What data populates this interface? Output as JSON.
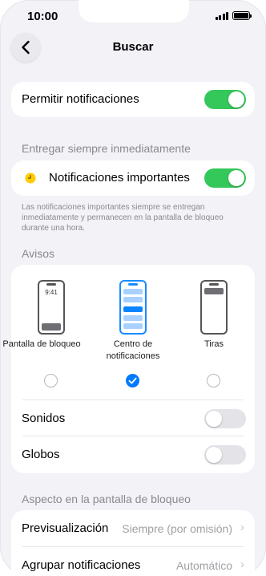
{
  "status": {
    "time": "10:00"
  },
  "header": {
    "title": "Buscar"
  },
  "allow": {
    "label": "Permitir notificaciones",
    "on": true
  },
  "immediate": {
    "header": "Entregar siempre inmediatamente",
    "label": "Notificaciones importantes",
    "on": true,
    "footnote": "Las notificaciones importantes siempre se entregan inmediatamente y permanecen en la pantalla de bloqueo durante una hora."
  },
  "alerts": {
    "header": "Avisos",
    "lock_time": "9:41",
    "options": [
      {
        "label": "Pantalla de bloqueo",
        "checked": false
      },
      {
        "label": "Centro de notificaciones",
        "checked": true
      },
      {
        "label": "Tiras",
        "checked": false
      }
    ],
    "sounds": {
      "label": "Sonidos",
      "on": false
    },
    "badges": {
      "label": "Globos",
      "on": false
    }
  },
  "lock_screen": {
    "header": "Aspecto en la pantalla de bloqueo",
    "preview": {
      "label": "Previsualización",
      "value": "Siempre (por omisión)"
    },
    "group": {
      "label": "Agrupar notificaciones",
      "value": "Automático"
    }
  },
  "colors": {
    "accent_green": "#34c759",
    "accent_blue": "#007aff",
    "icon_yellow": "#ffcc00"
  }
}
